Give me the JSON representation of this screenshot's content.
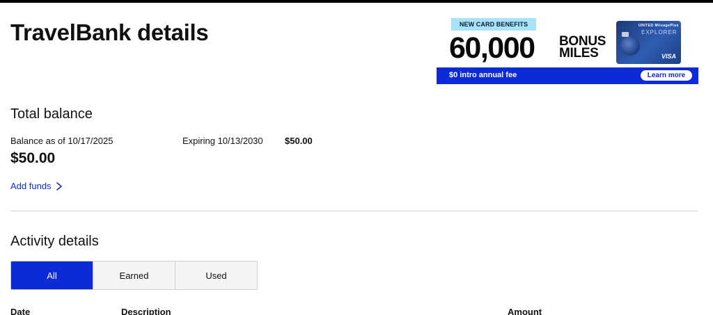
{
  "page": {
    "title": "TravelBank details"
  },
  "ad": {
    "badge": "NEW CARD BENEFITS",
    "miles_number": "60,000",
    "bonus_line1": "BONUS",
    "bonus_line2": "MILES",
    "card_brand": "UNITED MileagePlus",
    "card_name": "EXPLORER",
    "card_network": "VISA",
    "bar_text": "$0 intro annual fee",
    "learn_more": "Learn more"
  },
  "total_balance": {
    "title": "Total balance",
    "balance_label": "Balance as of 10/17/2025",
    "balance_amount": "$50.00",
    "expiring_label": "Expiring 10/13/2030",
    "expiring_amount": "$50.00",
    "add_funds": "Add funds"
  },
  "activity": {
    "title": "Activity details",
    "tabs": [
      {
        "label": "All",
        "active": true
      },
      {
        "label": "Earned",
        "active": false
      },
      {
        "label": "Used",
        "active": false
      }
    ],
    "columns": {
      "date": "Date",
      "description": "Description",
      "amount": "Amount"
    }
  },
  "colors": {
    "accent": "#0c2ad8",
    "badge": "#a8e4f7"
  },
  "icons": {
    "add_funds": "chevron-right-icon"
  }
}
